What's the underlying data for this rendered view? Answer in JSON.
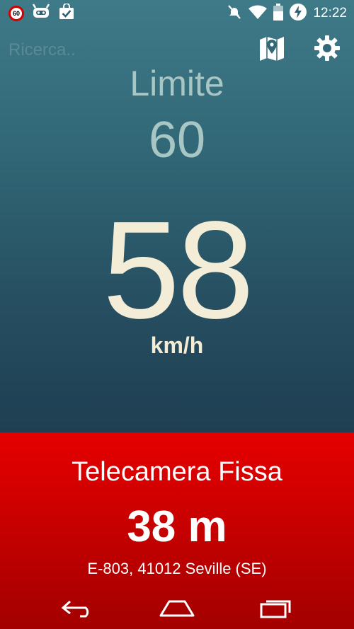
{
  "status_bar": {
    "speed_sign_value": "60",
    "time": "12:22",
    "icons": [
      "speed-limit-icon",
      "android-robot-icon",
      "shopping-bag-check-icon",
      "mute-icon",
      "wifi-icon",
      "battery-icon",
      "charging-bolt-icon"
    ]
  },
  "search": {
    "placeholder": "Ricerca.."
  },
  "toolbar": {
    "icons": [
      "map-pin-icon",
      "gear-icon"
    ]
  },
  "limit": {
    "label": "Limite",
    "value": "60"
  },
  "speed": {
    "value": "58",
    "unit": "km/h"
  },
  "alert": {
    "title": "Telecamera Fissa",
    "distance": "38 m",
    "address": "E-803, 41012 Seville (SE)"
  },
  "nav": {
    "icons": [
      "back-icon",
      "home-icon",
      "recents-icon"
    ]
  },
  "colors": {
    "gradient_top": "#3f7a88",
    "gradient_bottom": "#1f3e52",
    "limit_text": "#a7c6c4",
    "speed_text": "#f3ecd6",
    "alert_red": "#d00000"
  }
}
